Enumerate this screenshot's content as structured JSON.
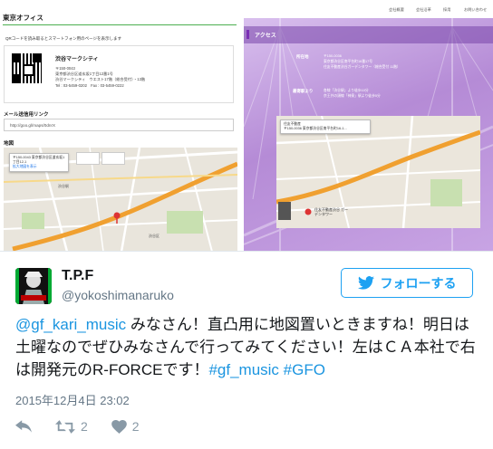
{
  "screenshot": {
    "left": {
      "title": "東京オフィス",
      "qr_note": "QRコードを読み取るとスマートフォン用のページを表示します",
      "office_name": "渋谷マークシティ",
      "address_lines": [
        "〒150-0043",
        "東京都渋谷区道玄坂1丁目12番1号",
        "渋谷マークシティ　ウエスト17階（総合受付）・13階",
        "Tel : 03-5459-0202　Fax : 03-5459-0222"
      ],
      "mail_label": "メール送信用リンク",
      "mail_url": "http://goo.gl/maps/0dnrX",
      "map_label": "地図",
      "map_info": [
        "〒150-0043 東京都渋谷区道玄坂1丁目12-1",
        "拡大地図を表示"
      ],
      "map_places": [
        "渋谷駅",
        "渋谷区"
      ]
    },
    "right": {
      "nav": [
        "会社概要",
        "会社沿革",
        "採用",
        "お問い合わせ"
      ],
      "access_title": "アクセス",
      "keys": [
        "所在地",
        "最寄駅より"
      ],
      "location_lines": [
        "〒150-0036",
        "東京都渋谷区南平台町16番17号",
        "住友不動産渋谷ガーデンタワー（総合受付 11階）"
      ],
      "station_lines": [
        "各線「渋谷駅」より徒歩10分",
        "京王井の頭線「神泉」駅より徒歩5分"
      ],
      "map_info": [
        "住友不動産",
        "〒150-0036 東京都渋谷区南平台町16-1..."
      ],
      "map_pin_label": "住友不動産渋谷 ガーデンタワー"
    }
  },
  "tweet": {
    "name": "T.P.F",
    "handle": "@yokoshimanaruko",
    "follow_label": "フォローする",
    "body": [
      {
        "text": "@gf_kari_music",
        "link": true
      },
      {
        "text": " みなさん！直凸用に地図置いときますね！明日は土曜なのでぜひみなさんで行ってみてください！左はＣＡ本社で右は開発元のR-FORCEです！",
        "link": false
      },
      {
        "text": "#gf_music",
        "link": true
      },
      {
        "text": " ",
        "link": false
      },
      {
        "text": "#GFO",
        "link": true
      }
    ],
    "date": "2015年12月4日 23:02",
    "retweet_count": "2",
    "like_count": "2",
    "colors": {
      "link": "#1b95e0",
      "muted": "#657786",
      "icon": "#8899a6"
    },
    "icons": [
      "reply-icon",
      "retweet-icon",
      "like-icon",
      "twitter-bird-icon"
    ]
  }
}
